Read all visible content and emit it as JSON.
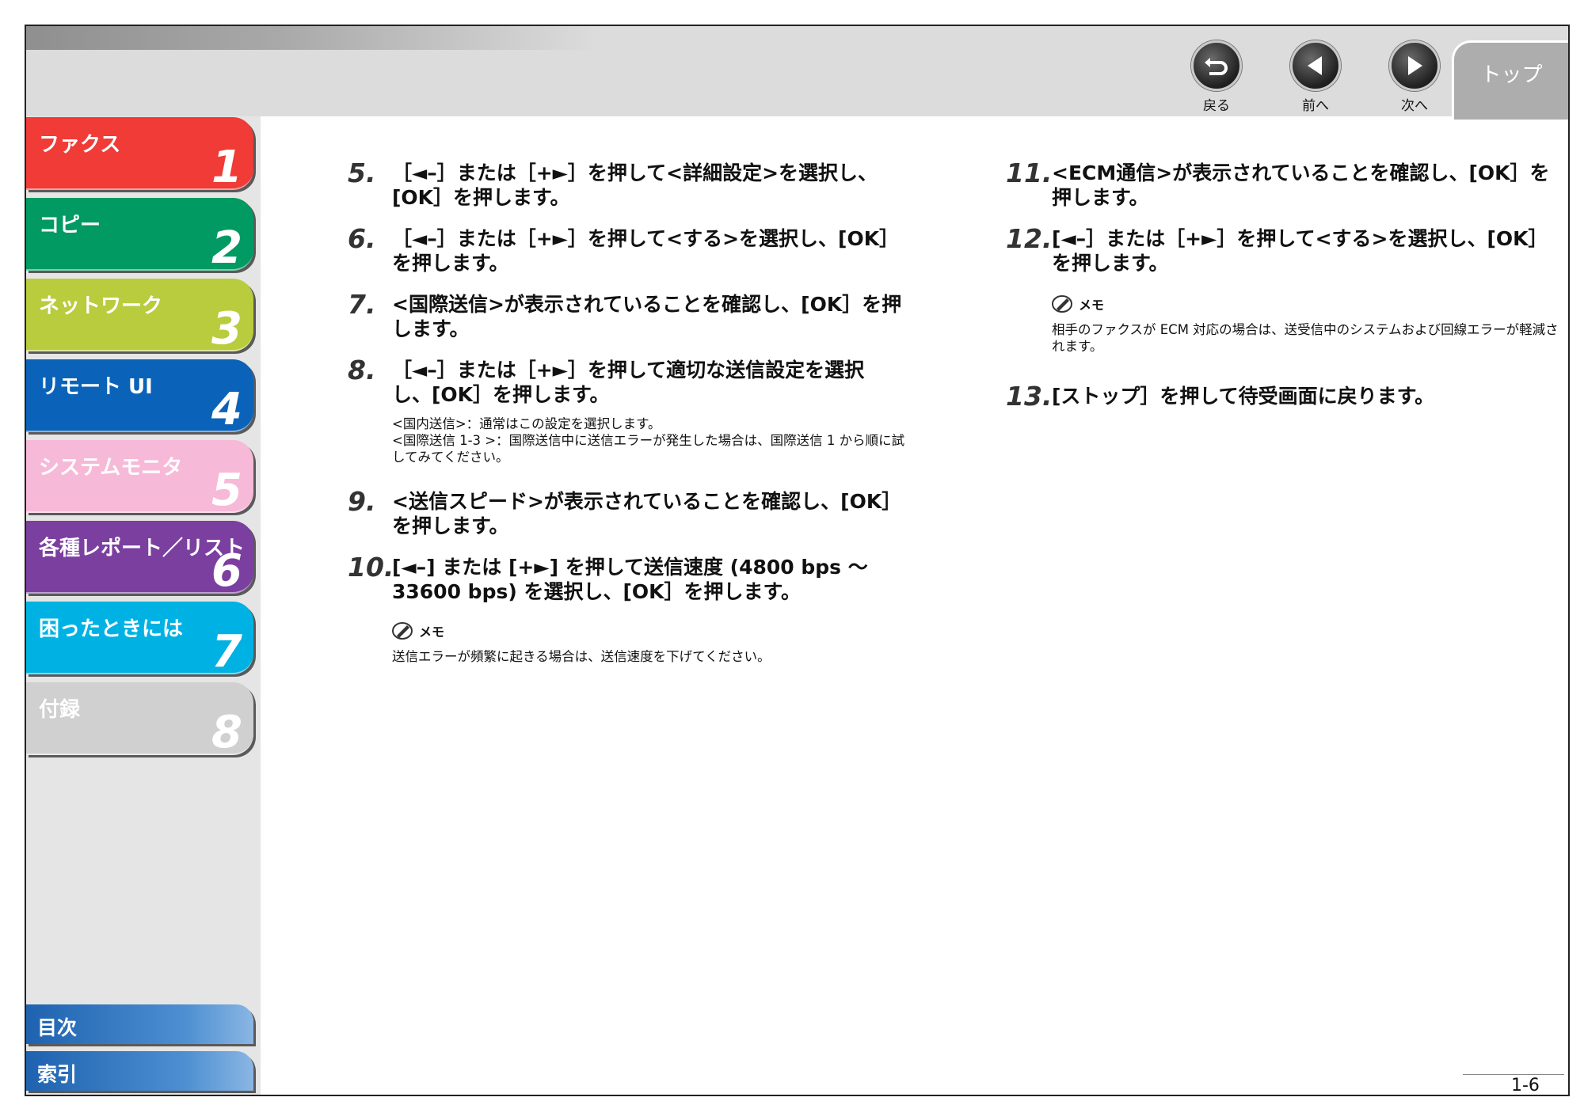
{
  "nav": {
    "back": "戻る",
    "prev": "前へ",
    "next": "次へ",
    "top": "トップ"
  },
  "chapters": [
    {
      "name": "ファクス",
      "num": "1",
      "color": "#f03b37"
    },
    {
      "name": "コピー",
      "num": "2",
      "color": "#009a62"
    },
    {
      "name": "ネットワーク",
      "num": "3",
      "color": "#b8cc3d"
    },
    {
      "name": "リモート UI",
      "num": "4",
      "color": "#0a63b8"
    },
    {
      "name": "システムモニタ",
      "num": "5",
      "color": "#f7b9d8"
    },
    {
      "name": "各種レポート／リスト",
      "num": "6",
      "color": "#7b3fa0"
    },
    {
      "name": "困ったときには",
      "num": "7",
      "color": "#00b2e3"
    },
    {
      "name": "付録",
      "num": "8",
      "color": "#d0d0d0"
    }
  ],
  "bottom_tabs": {
    "contents": "目次",
    "index": "索引"
  },
  "steps": [
    {
      "num": "5.",
      "text": "［◄–］または［+►］を押して<詳細設定>を選択し、[OK］を押します。"
    },
    {
      "num": "6.",
      "text": "［◄–］または［+►］を押して<する>を選択し、[OK］を押します。"
    },
    {
      "num": "7.",
      "text": "<国際送信>が表示されていることを確認し、[OK］を押します。"
    },
    {
      "num": "8.",
      "text": "［◄–］または［+►］を押して適切な送信設定を選択し、[OK］を押します。"
    },
    {
      "num": "9.",
      "text": "<送信スピード>が表示されていることを確認し、[OK］を押します。"
    },
    {
      "num": "10.",
      "text": "[◄–] または [+►] を押して送信速度 (4800 bps ～ 33600 bps) を選択し、[OK］を押します。"
    },
    {
      "num": "11.",
      "text": "<ECM通信>が表示されていることを確認し、[OK］を押します。"
    },
    {
      "num": "12.",
      "text": "[◄–］または［+►］を押して<する>を選択し、[OK］を押します。"
    },
    {
      "num": "13.",
      "text": "[ストップ］を押して待受画面に戻ります。"
    }
  ],
  "step8_notes": {
    "line1": "<国内送信>：通常はこの設定を選択します。",
    "line2": "<国際送信 1-3 >：国際送信中に送信エラーが発生した場合は、国際送信 1 から順に試してみてください。"
  },
  "memo1": {
    "label": "メモ",
    "text": "送信エラーが頻繁に起きる場合は、送信速度を下げてください。"
  },
  "memo2": {
    "label": "メモ",
    "text": "相手のファクスが ECM 対応の場合は、送受信中のシステムおよび回線エラーが軽減されます。"
  },
  "page_number": "1-6"
}
